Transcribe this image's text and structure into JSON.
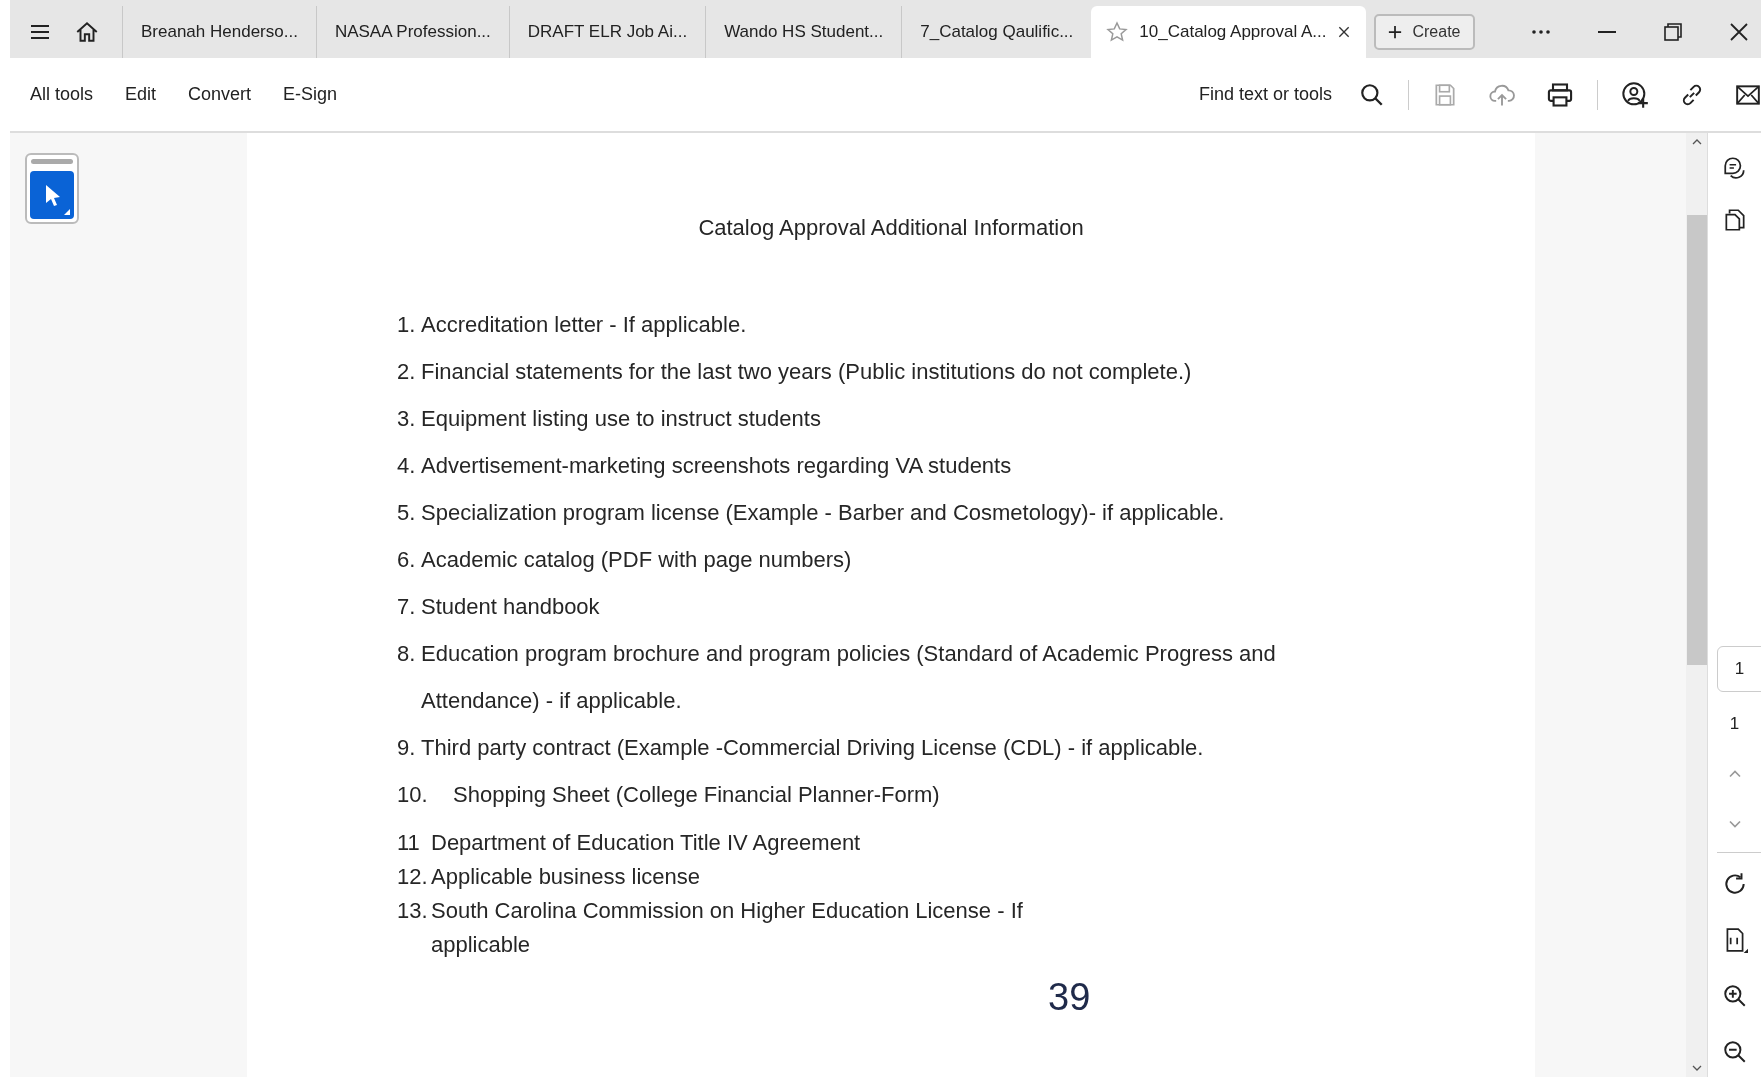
{
  "tabs": [
    {
      "label": "Breanah Henderso...",
      "selected": false
    },
    {
      "label": "NASAA Profession...",
      "selected": false
    },
    {
      "label": "DRAFT ELR Job Ai...",
      "selected": false
    },
    {
      "label": "Wando HS Student...",
      "selected": false
    },
    {
      "label": "7_Catalog Qaulific...",
      "selected": false
    },
    {
      "label": "10_Catalog Approval A...",
      "selected": true
    }
  ],
  "create_button": "Create",
  "menu": [
    "All tools",
    "Edit",
    "Convert",
    "E-Sign"
  ],
  "find": "Find text or tools",
  "document": {
    "title": "Catalog Approval Additional Information",
    "items": [
      {
        "number": "1.",
        "kind": "spaced",
        "lines": [
          "Accreditation letter - If applicable."
        ]
      },
      {
        "number": "2.",
        "kind": "spaced",
        "lines": [
          "Financial statements for the last two years (Public institutions do not complete.)"
        ]
      },
      {
        "number": "3.",
        "kind": "spaced",
        "lines": [
          "Equipment listing use to instruct students"
        ]
      },
      {
        "number": "4.",
        "kind": "spaced",
        "lines": [
          "Advertisement-marketing screenshots regarding VA students"
        ]
      },
      {
        "number": "5.",
        "kind": "spaced",
        "lines": [
          "Specialization program license (Example - Barber and Cosmetology)- if applicable."
        ]
      },
      {
        "number": "6.",
        "kind": "spaced",
        "lines": [
          "Academic catalog (PDF with page numbers)"
        ]
      },
      {
        "number": "7.",
        "kind": "spaced",
        "lines": [
          "Student handbook"
        ]
      },
      {
        "number": "8.",
        "kind": "spaced",
        "lines": [
          "Education program brochure and program policies (Standard of Academic Progress and",
          "Attendance) - if applicable."
        ]
      },
      {
        "number": "9.",
        "kind": "spaced",
        "lines": [
          "Third party contract (Example -Commercial Driving License (CDL) - if applicable."
        ]
      },
      {
        "number": "10.",
        "kind": "wide",
        "lines": [
          "Shopping Sheet (College Financial Planner-Form)"
        ]
      },
      {
        "number": "11",
        "kind": "compact",
        "lines": [
          "Department of Education Title IV Agreement"
        ]
      },
      {
        "number": "12.",
        "kind": "compact",
        "lines": [
          "Applicable business license"
        ]
      },
      {
        "number": "13.",
        "kind": "compact",
        "lines": [
          "South Carolina Commission on Higher Education License - If",
          "applicable"
        ]
      }
    ],
    "page_number": "39"
  },
  "page_field": "1",
  "page_count": "1"
}
